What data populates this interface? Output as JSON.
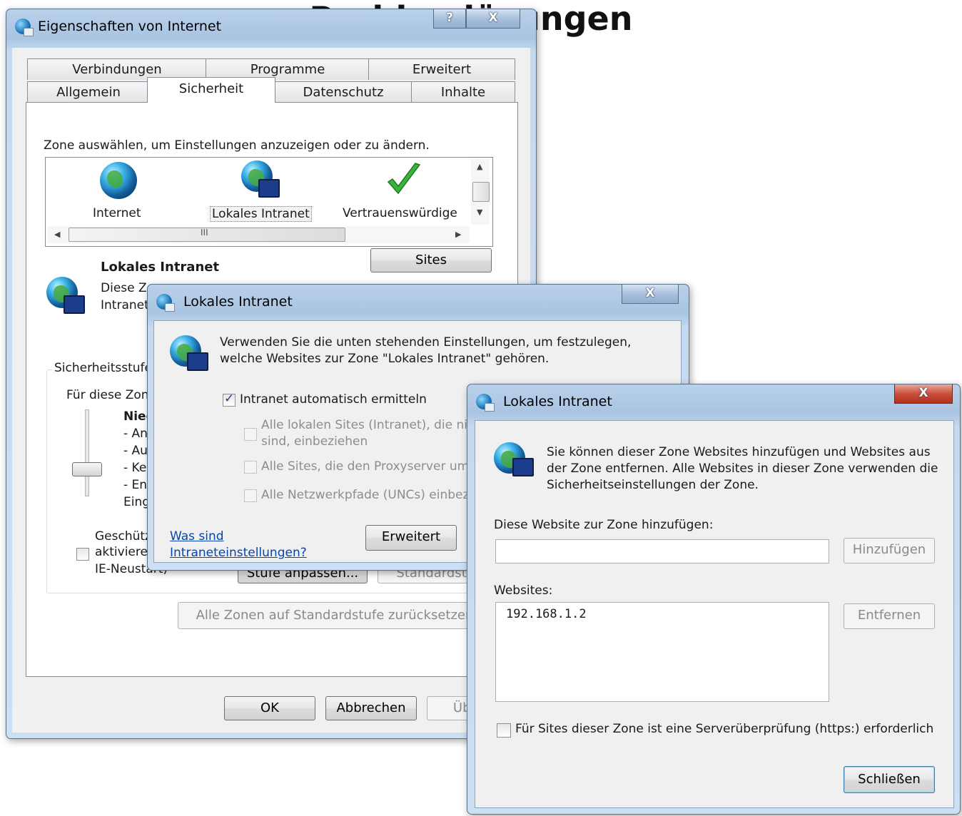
{
  "background_title": "Problemlösungen",
  "main_window": {
    "title": "Eigenschaften von Internet",
    "help_button": "?",
    "close_button": "X",
    "tabs_row1": [
      "Verbindungen",
      "Programme",
      "Erweitert"
    ],
    "tabs_row2": [
      "Allgemein",
      "Sicherheit",
      "Datenschutz",
      "Inhalte"
    ],
    "active_tab": "Sicherheit",
    "zone_prompt": "Zone auswählen, um Einstellungen anzuzeigen oder zu ändern.",
    "zones": [
      {
        "label": "Internet",
        "icon": "globe-icon"
      },
      {
        "label": "Lokales Intranet",
        "icon": "intranet-globe-icon"
      },
      {
        "label": "Vertrauenswürdige",
        "icon": "checkmark-icon"
      }
    ],
    "scroll_indicator": "III",
    "sites_button": "Sites",
    "zone_heading": "Lokales Intranet",
    "zone_desc_line1": "Diese Zo",
    "zone_desc_line2": "Intranet",
    "security_group_label": "Sicherheitsstufe",
    "for_this_zone": "Für diese Zon",
    "level_title": "Nied",
    "level_items": [
      "- An",
      "- Au",
      "- Kei",
      "- En",
      "Eing"
    ],
    "protected_line1": "Geschütz",
    "protected_line2": "aktivierer",
    "protected_line3": "IE-Neustart)",
    "custom_level_button": "Stufe anpassen...",
    "default_level_button": "Standardstufe",
    "reset_all_button": "Alle Zonen auf Standardstufe zurücksetzen",
    "ok_button": "OK",
    "cancel_button": "Abbrechen",
    "apply_button": "Übern"
  },
  "intranet_dialog": {
    "title": "Lokales Intranet",
    "close_button": "X",
    "description_line1": "Verwenden Sie die unten stehenden Einstellungen, um festzulegen,",
    "description_line2": "welche Websites zur Zone \"Lokales Intranet\" gehören.",
    "auto_detect_label": "Intranet automatisch ermitteln",
    "auto_detect_checked": true,
    "opt_local_sites_line1": "Alle lokalen Sites (Intranet), die ni",
    "opt_local_sites_line2": "sind, einbeziehen",
    "opt_proxy_bypass": "Alle Sites, die den Proxyserver um",
    "opt_unc_paths": "Alle Netzwerkpfade (UNCs) einbez",
    "help_link_line1": "Was sind",
    "help_link_line2": "Intraneteinstellungen?",
    "advanced_button": "Erweitert"
  },
  "sites_dialog": {
    "title": "Lokales Intranet",
    "close_button": "X",
    "description_line1": "Sie können dieser Zone Websites hinzufügen und Websites aus",
    "description_line2": "der Zone entfernen. Alle Websites in dieser Zone verwenden die",
    "description_line3": "Sicherheitseinstellungen der Zone.",
    "add_label": "Diese Website zur Zone hinzufügen:",
    "add_input_value": "",
    "add_button": "Hinzufügen",
    "websites_label": "Websites:",
    "websites": [
      "192.168.1.2"
    ],
    "remove_button": "Entfernen",
    "https_label": "Für Sites dieser Zone ist eine Serverüberprüfung (https:) erforderlich",
    "https_checked": false,
    "close_dialog_button": "Schließen"
  },
  "colors": {
    "title_glass": "#b9d1ea",
    "close_red": "#c8503c",
    "link_blue": "#0645ad",
    "checkmark_green": "#3cb43c"
  }
}
